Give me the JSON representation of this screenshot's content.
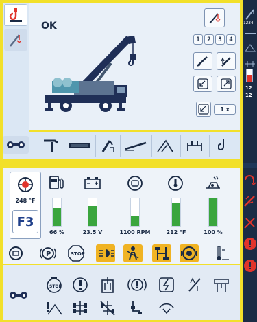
{
  "top": {
    "status_label": "OK",
    "counter_digits": [
      "1",
      "2",
      "3",
      "4"
    ],
    "multiplier_label": "1 x",
    "right_strip": {
      "readout_top": "1234",
      "readout_mid": "12",
      "readout_bottom": "12"
    }
  },
  "bottom": {
    "engine_temp_value": "248 °F",
    "gear_label": "F3",
    "gauges": [
      {
        "name": "fuel",
        "icon": "fuel-pump-icon",
        "value_label": "66 %",
        "fill": 0.66
      },
      {
        "name": "battery",
        "icon": "battery-icon",
        "value_label": "23.5 V",
        "fill": 0.72
      },
      {
        "name": "engine-speed",
        "icon": "engine-speed-icon",
        "value_label": "1100 RPM",
        "fill": 0.38
      },
      {
        "name": "coolant",
        "icon": "coolant-icon",
        "value_label": "212 °F",
        "fill": 0.82
      },
      {
        "name": "adblue",
        "icon": "def-fluid-icon",
        "value_label": "100 %",
        "fill": 1.0
      }
    ]
  },
  "colors": {
    "frame": "#f2e02a",
    "panel": "#e9f0f8",
    "gauge_fill": "#3aa53e",
    "warning_fill": "#f0b323",
    "alarm_red": "#e0342b",
    "dark": "#1f3758"
  },
  "icons": {
    "side_tabs": [
      "crane-hook-icon",
      "crane-boom-icon"
    ],
    "top_right_buttons": [
      "hook-block-icon",
      "counter-icon",
      "boom-angle-icon",
      "boom-lift-icon",
      "outrigger-left-icon",
      "outrigger-right-icon",
      "outrigger-set-icon"
    ],
    "toolbar": [
      "rigging-icon",
      "main-boom-icon",
      "telescope-icon",
      "jib-icon",
      "luffing-icon",
      "outrigger-icon",
      "hook-icon"
    ],
    "status_row": [
      "engine-icon",
      "parking-brake-icon",
      "stop-icon",
      "lights-warning-icon",
      "seatbelt-warning-icon",
      "drive-warning-icon",
      "engine-warning-icon",
      "temperature-warning-icon"
    ],
    "sub_row_1": [
      "stop-engine-icon",
      "brake-warning-icon",
      "filter-icon",
      "brake-circle-icon",
      "electrical-warning-icon",
      "tilt-icon",
      "crane-view-icon"
    ],
    "sub_row_2": [
      "slope-warning-icon",
      "axle-icon",
      "axle-lock-icon",
      "steering-icon",
      "wipers-icon"
    ],
    "right_alarm_strip": [
      "hook-alarm-icon",
      "boom-alarm-icon",
      "outrigger-alarm-icon",
      "error-1-icon",
      "error-2-icon"
    ]
  }
}
